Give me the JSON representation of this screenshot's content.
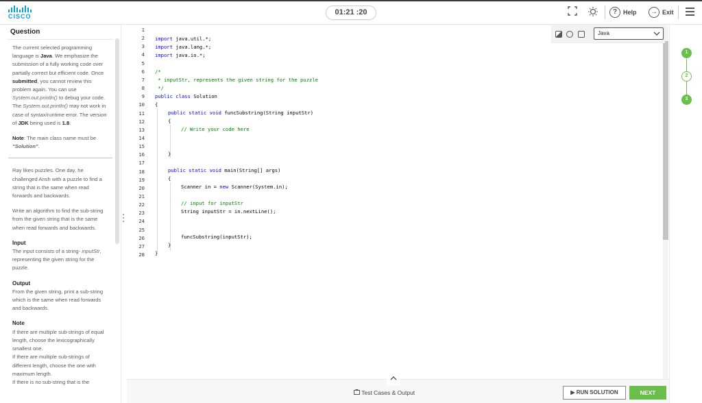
{
  "header": {
    "logo_text": "CISCO",
    "timer": "01:21 :20",
    "help_label": "Help",
    "exit_label": "Exit"
  },
  "question": {
    "title": "Question",
    "intro_1": "The current selected programming language is ",
    "intro_lang": "Java",
    "intro_2": ". We emphasize the submission of a fully working code over partially correct but efficient code. Once ",
    "intro_submitted": "submitted",
    "intro_3": ", you cannot review this problem again. You can use ",
    "intro_println": "System.out.println()",
    "intro_4": " to debug your code. The ",
    "intro_println2": "System.out.println()",
    "intro_5": " may not work in case of syntax/runtime error. The version of ",
    "intro_jdk": "JDK",
    "intro_6": " being used is ",
    "intro_version": "1.8",
    "intro_7": ".",
    "note_label": "Note",
    "note_text": ": The main class name must be ",
    "note_class": "\"Solution\"",
    "note_end": ".",
    "problem_1": "Ray likes puzzles. One day, he challenged Ansh with a puzzle to find a string that is the same when read forwards and backwards.",
    "problem_2": "Write an algorithm to find the sub-string from the given string that is the same when read forwards and backwards.",
    "input_header": "Input",
    "input_1": "The input consists of a string- ",
    "input_var": "inputStr",
    "input_2": ", representing the given string for the puzzle.",
    "output_header": "Output",
    "output_text": "From the given string, print a sub-string which is the same when read forwards and backwards.",
    "note2_header": "Note",
    "note2_1": "If there are multiple sub-strings of equal length, choose the lexicographically smallest one.",
    "note2_2": "If there are multiple sub-strings of different length, choose the one with maximum length.",
    "note2_3": "If there is no sub-string that is the"
  },
  "editor": {
    "language": "Java",
    "line_numbers": [
      "1",
      "2",
      "3",
      "4",
      "5",
      "6",
      "7",
      "8",
      "9",
      "10",
      "11",
      "12",
      "13",
      "14",
      "15",
      "16",
      "17",
      "18",
      "19",
      "20",
      "21",
      "22",
      "23",
      "24",
      "25",
      "26",
      "27",
      "28"
    ],
    "lines": {
      "l2_kw": "import",
      "l2_rest": " java.util.*;",
      "l3_kw": "import",
      "l3_rest": " java.lang.*;",
      "l4_kw": "import",
      "l4_rest": " java.io.*;",
      "l6": "/*",
      "l7": " * inputStr, represents the given string for the puzzle",
      "l8": " */",
      "l9_kw": "public class",
      "l9_rest": " Solution",
      "l10": "{",
      "l11_kw": "public static void",
      "l11_rest": " funcSubstring(String inputStr)",
      "l12": "{",
      "l13": "// Write your code here",
      "l16": "}",
      "l18_kw": "public static void",
      "l18_rest": " main(String[] args)",
      "l19": "{",
      "l20_a": "Scanner in = ",
      "l20_kw": "new",
      "l20_b": " Scanner(System.in);",
      "l22": "// input for inputStr",
      "l23": "String inputStr = in.nextLine();",
      "l26": "funcSubstring(inputStr);",
      "l27": "}",
      "l28": "}"
    }
  },
  "steps": [
    "1",
    "2",
    "3"
  ],
  "bottom": {
    "test_cases_label": "Test Cases & Output",
    "run_label": "RUN SOLUTION",
    "next_label": "NEXT"
  },
  "colors": {
    "accent_green": "#6abf4b",
    "cisco_blue": "#049fd9",
    "keyword_blue": "#0000ff",
    "comment_green": "#008000"
  }
}
